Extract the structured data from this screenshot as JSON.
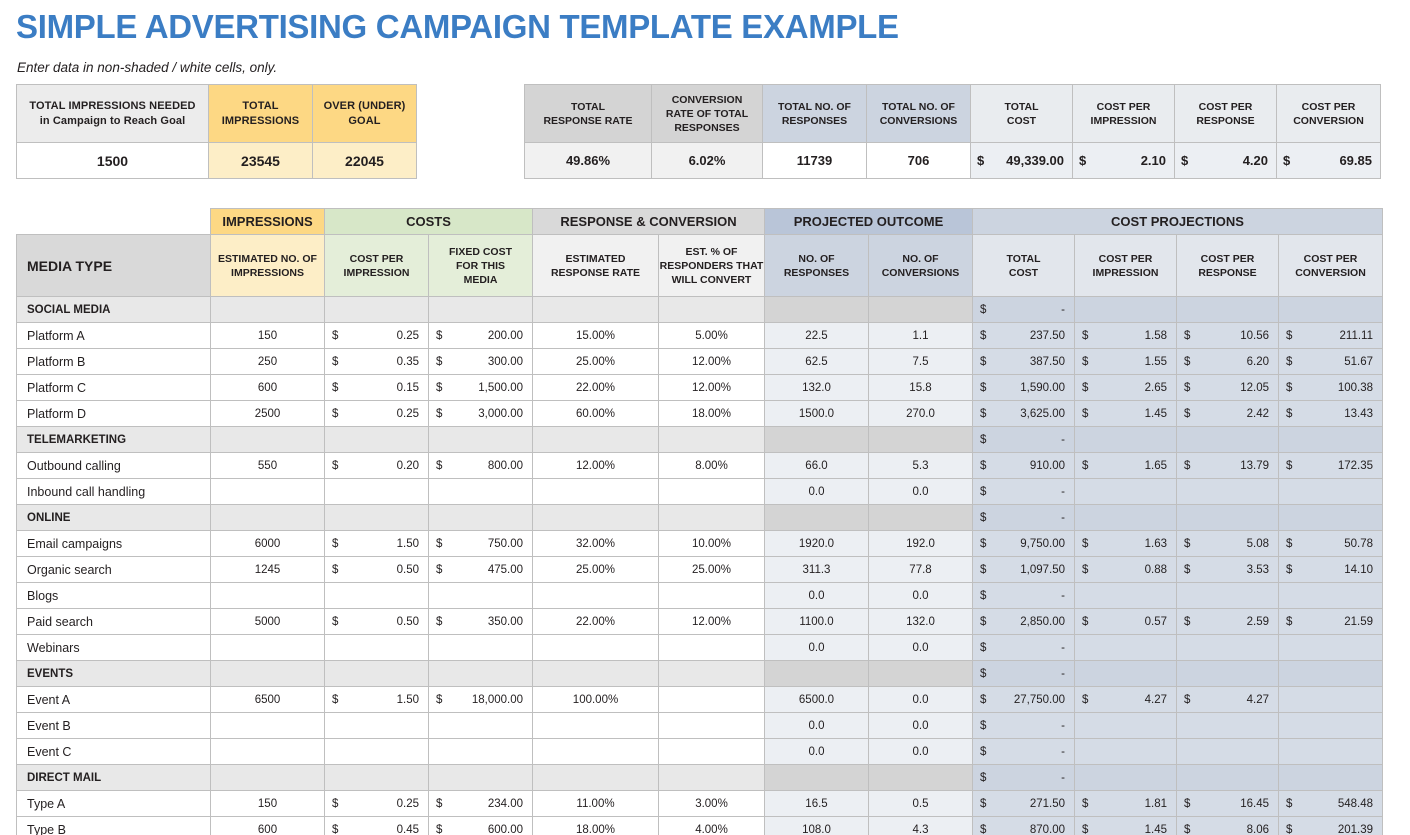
{
  "title": "SIMPLE ADVERTISING CAMPAIGN TEMPLATE EXAMPLE",
  "subtitle": "Enter data in non-shaded / white cells, only.",
  "colors": {
    "title": "#3b7dc4",
    "impressions": "#fdd884",
    "costs": "#d7e7c8",
    "projected": "#b9c5d8",
    "costprojections": "#ccd4e0"
  },
  "summary_left": {
    "headers": [
      "TOTAL IMPRESSIONS NEEDED|in Campaign to Reach Goal",
      "TOTAL|IMPRESSIONS",
      "OVER (UNDER)|GOAL"
    ],
    "h0a": "TOTAL IMPRESSIONS NEEDED",
    "h0b": "in Campaign to Reach Goal",
    "h1a": "TOTAL",
    "h1b": "IMPRESSIONS",
    "h2a": "OVER (UNDER)",
    "h2b": "GOAL",
    "values": [
      "1500",
      "23545",
      "22045"
    ]
  },
  "summary_right": {
    "h0a": "TOTAL",
    "h0b": "RESPONSE RATE",
    "h1a": "CONVERSION",
    "h1b": "RATE OF TOTAL",
    "h1c": "RESPONSES",
    "h2a": "TOTAL NO. OF",
    "h2b": "RESPONSES",
    "h3a": "TOTAL NO. OF",
    "h3b": "CONVERSIONS",
    "h4a": "TOTAL",
    "h4b": "COST",
    "h5a": "COST PER",
    "h5b": "IMPRESSION",
    "h6a": "COST PER",
    "h6b": "RESPONSE",
    "h7a": "COST PER",
    "h7b": "CONVERSION",
    "v0": "49.86%",
    "v1": "6.02%",
    "v2": "11739",
    "v3": "706",
    "v4_sym": "$",
    "v4": "49,339.00",
    "v5_sym": "$",
    "v5": "2.10",
    "v6_sym": "$",
    "v6": "4.20",
    "v7_sym": "$",
    "v7": "69.85"
  },
  "main": {
    "groups": {
      "impressions": "IMPRESSIONS",
      "costs": "COSTS",
      "response": "RESPONSE & CONVERSION",
      "projected": "PROJECTED OUTCOME",
      "costprojections": "COST PROJECTIONS"
    },
    "subheaders": {
      "media": "MEDIA TYPE",
      "est_impressions_a": "ESTIMATED NO. OF",
      "est_impressions_b": "IMPRESSIONS",
      "cost_per_impression_a": "COST PER",
      "cost_per_impression_b": "IMPRESSION",
      "fixed_cost_a": "FIXED COST",
      "fixed_cost_b": "FOR THIS",
      "fixed_cost_c": "MEDIA",
      "est_response_a": "ESTIMATED",
      "est_response_b": "RESPONSE RATE",
      "est_convert_a": "EST. % OF",
      "est_convert_b": "RESPONDERS THAT",
      "est_convert_c": "WILL CONVERT",
      "no_responses_a": "NO. OF",
      "no_responses_b": "RESPONSES",
      "no_conversions_a": "NO. OF",
      "no_conversions_b": "CONVERSIONS",
      "total_cost_a": "TOTAL",
      "total_cost_b": "COST",
      "cpi_a": "COST PER",
      "cpi_b": "IMPRESSION",
      "cpr_a": "COST PER",
      "cpr_b": "RESPONSE",
      "cpc_a": "COST PER",
      "cpc_b": "CONVERSION"
    },
    "rows": [
      {
        "type": "section",
        "label": "SOCIAL MEDIA",
        "total_cost_sym": "$",
        "total_cost": "-"
      },
      {
        "type": "item",
        "label": "Platform A",
        "impressions": "150",
        "cpi_sym": "$",
        "cpi": "0.25",
        "fixed_sym": "$",
        "fixed": "200.00",
        "resp_rate": "15.00%",
        "convert_pct": "5.00%",
        "responses": "22.5",
        "conversions": "1.1",
        "total_cost_sym": "$",
        "total_cost": "237.50",
        "p_cpi_sym": "$",
        "p_cpi": "1.58",
        "p_cpr_sym": "$",
        "p_cpr": "10.56",
        "p_cpc_sym": "$",
        "p_cpc": "211.11"
      },
      {
        "type": "item",
        "label": "Platform B",
        "impressions": "250",
        "cpi_sym": "$",
        "cpi": "0.35",
        "fixed_sym": "$",
        "fixed": "300.00",
        "resp_rate": "25.00%",
        "convert_pct": "12.00%",
        "responses": "62.5",
        "conversions": "7.5",
        "total_cost_sym": "$",
        "total_cost": "387.50",
        "p_cpi_sym": "$",
        "p_cpi": "1.55",
        "p_cpr_sym": "$",
        "p_cpr": "6.20",
        "p_cpc_sym": "$",
        "p_cpc": "51.67"
      },
      {
        "type": "item",
        "label": "Platform C",
        "impressions": "600",
        "cpi_sym": "$",
        "cpi": "0.15",
        "fixed_sym": "$",
        "fixed": "1,500.00",
        "resp_rate": "22.00%",
        "convert_pct": "12.00%",
        "responses": "132.0",
        "conversions": "15.8",
        "total_cost_sym": "$",
        "total_cost": "1,590.00",
        "p_cpi_sym": "$",
        "p_cpi": "2.65",
        "p_cpr_sym": "$",
        "p_cpr": "12.05",
        "p_cpc_sym": "$",
        "p_cpc": "100.38"
      },
      {
        "type": "item",
        "label": "Platform D",
        "impressions": "2500",
        "cpi_sym": "$",
        "cpi": "0.25",
        "fixed_sym": "$",
        "fixed": "3,000.00",
        "resp_rate": "60.00%",
        "convert_pct": "18.00%",
        "responses": "1500.0",
        "conversions": "270.0",
        "total_cost_sym": "$",
        "total_cost": "3,625.00",
        "p_cpi_sym": "$",
        "p_cpi": "1.45",
        "p_cpr_sym": "$",
        "p_cpr": "2.42",
        "p_cpc_sym": "$",
        "p_cpc": "13.43"
      },
      {
        "type": "section",
        "label": "TELEMARKETING",
        "total_cost_sym": "$",
        "total_cost": "-"
      },
      {
        "type": "item",
        "label": "Outbound calling",
        "impressions": "550",
        "cpi_sym": "$",
        "cpi": "0.20",
        "fixed_sym": "$",
        "fixed": "800.00",
        "resp_rate": "12.00%",
        "convert_pct": "8.00%",
        "responses": "66.0",
        "conversions": "5.3",
        "total_cost_sym": "$",
        "total_cost": "910.00",
        "p_cpi_sym": "$",
        "p_cpi": "1.65",
        "p_cpr_sym": "$",
        "p_cpr": "13.79",
        "p_cpc_sym": "$",
        "p_cpc": "172.35"
      },
      {
        "type": "item",
        "label": "Inbound call handling",
        "impressions": "",
        "cpi_sym": "",
        "cpi": "",
        "fixed_sym": "",
        "fixed": "",
        "resp_rate": "",
        "convert_pct": "",
        "responses": "0.0",
        "conversions": "0.0",
        "total_cost_sym": "$",
        "total_cost": "-",
        "p_cpi_sym": "",
        "p_cpi": "",
        "p_cpr_sym": "",
        "p_cpr": "",
        "p_cpc_sym": "",
        "p_cpc": ""
      },
      {
        "type": "section",
        "label": "ONLINE",
        "total_cost_sym": "$",
        "total_cost": "-"
      },
      {
        "type": "item",
        "label": "Email campaigns",
        "impressions": "6000",
        "cpi_sym": "$",
        "cpi": "1.50",
        "fixed_sym": "$",
        "fixed": "750.00",
        "resp_rate": "32.00%",
        "convert_pct": "10.00%",
        "responses": "1920.0",
        "conversions": "192.0",
        "total_cost_sym": "$",
        "total_cost": "9,750.00",
        "p_cpi_sym": "$",
        "p_cpi": "1.63",
        "p_cpr_sym": "$",
        "p_cpr": "5.08",
        "p_cpc_sym": "$",
        "p_cpc": "50.78"
      },
      {
        "type": "item",
        "label": "Organic search",
        "impressions": "1245",
        "cpi_sym": "$",
        "cpi": "0.50",
        "fixed_sym": "$",
        "fixed": "475.00",
        "resp_rate": "25.00%",
        "convert_pct": "25.00%",
        "responses": "311.3",
        "conversions": "77.8",
        "total_cost_sym": "$",
        "total_cost": "1,097.50",
        "p_cpi_sym": "$",
        "p_cpi": "0.88",
        "p_cpr_sym": "$",
        "p_cpr": "3.53",
        "p_cpc_sym": "$",
        "p_cpc": "14.10"
      },
      {
        "type": "item",
        "label": "Blogs",
        "impressions": "",
        "cpi_sym": "",
        "cpi": "",
        "fixed_sym": "",
        "fixed": "",
        "resp_rate": "",
        "convert_pct": "",
        "responses": "0.0",
        "conversions": "0.0",
        "total_cost_sym": "$",
        "total_cost": "-",
        "p_cpi_sym": "",
        "p_cpi": "",
        "p_cpr_sym": "",
        "p_cpr": "",
        "p_cpc_sym": "",
        "p_cpc": ""
      },
      {
        "type": "item",
        "label": "Paid search",
        "impressions": "5000",
        "cpi_sym": "$",
        "cpi": "0.50",
        "fixed_sym": "$",
        "fixed": "350.00",
        "resp_rate": "22.00%",
        "convert_pct": "12.00%",
        "responses": "1100.0",
        "conversions": "132.0",
        "total_cost_sym": "$",
        "total_cost": "2,850.00",
        "p_cpi_sym": "$",
        "p_cpi": "0.57",
        "p_cpr_sym": "$",
        "p_cpr": "2.59",
        "p_cpc_sym": "$",
        "p_cpc": "21.59"
      },
      {
        "type": "item",
        "label": "Webinars",
        "impressions": "",
        "cpi_sym": "",
        "cpi": "",
        "fixed_sym": "",
        "fixed": "",
        "resp_rate": "",
        "convert_pct": "",
        "responses": "0.0",
        "conversions": "0.0",
        "total_cost_sym": "$",
        "total_cost": "-",
        "p_cpi_sym": "",
        "p_cpi": "",
        "p_cpr_sym": "",
        "p_cpr": "",
        "p_cpc_sym": "",
        "p_cpc": ""
      },
      {
        "type": "section",
        "label": "EVENTS",
        "total_cost_sym": "$",
        "total_cost": "-"
      },
      {
        "type": "item",
        "label": "Event A",
        "impressions": "6500",
        "cpi_sym": "$",
        "cpi": "1.50",
        "fixed_sym": "$",
        "fixed": "18,000.00",
        "resp_rate": "100.00%",
        "convert_pct": "",
        "responses": "6500.0",
        "conversions": "0.0",
        "total_cost_sym": "$",
        "total_cost": "27,750.00",
        "p_cpi_sym": "$",
        "p_cpi": "4.27",
        "p_cpr_sym": "$",
        "p_cpr": "4.27",
        "p_cpc_sym": "",
        "p_cpc": ""
      },
      {
        "type": "item",
        "label": "Event B",
        "impressions": "",
        "cpi_sym": "",
        "cpi": "",
        "fixed_sym": "",
        "fixed": "",
        "resp_rate": "",
        "convert_pct": "",
        "responses": "0.0",
        "conversions": "0.0",
        "total_cost_sym": "$",
        "total_cost": "-",
        "p_cpi_sym": "",
        "p_cpi": "",
        "p_cpr_sym": "",
        "p_cpr": "",
        "p_cpc_sym": "",
        "p_cpc": ""
      },
      {
        "type": "item",
        "label": "Event C",
        "impressions": "",
        "cpi_sym": "",
        "cpi": "",
        "fixed_sym": "",
        "fixed": "",
        "resp_rate": "",
        "convert_pct": "",
        "responses": "0.0",
        "conversions": "0.0",
        "total_cost_sym": "$",
        "total_cost": "-",
        "p_cpi_sym": "",
        "p_cpi": "",
        "p_cpr_sym": "",
        "p_cpr": "",
        "p_cpc_sym": "",
        "p_cpc": ""
      },
      {
        "type": "section",
        "label": "DIRECT MAIL",
        "total_cost_sym": "$",
        "total_cost": "-"
      },
      {
        "type": "item",
        "label": "Type A",
        "impressions": "150",
        "cpi_sym": "$",
        "cpi": "0.25",
        "fixed_sym": "$",
        "fixed": "234.00",
        "resp_rate": "11.00%",
        "convert_pct": "3.00%",
        "responses": "16.5",
        "conversions": "0.5",
        "total_cost_sym": "$",
        "total_cost": "271.50",
        "p_cpi_sym": "$",
        "p_cpi": "1.81",
        "p_cpr_sym": "$",
        "p_cpr": "16.45",
        "p_cpc_sym": "$",
        "p_cpc": "548.48"
      },
      {
        "type": "item",
        "label": "Type B",
        "impressions": "600",
        "cpi_sym": "$",
        "cpi": "0.45",
        "fixed_sym": "$",
        "fixed": "600.00",
        "resp_rate": "18.00%",
        "convert_pct": "4.00%",
        "responses": "108.0",
        "conversions": "4.3",
        "total_cost_sym": "$",
        "total_cost": "870.00",
        "p_cpi_sym": "$",
        "p_cpi": "1.45",
        "p_cpr_sym": "$",
        "p_cpr": "8.06",
        "p_cpc_sym": "$",
        "p_cpc": "201.39"
      }
    ]
  }
}
